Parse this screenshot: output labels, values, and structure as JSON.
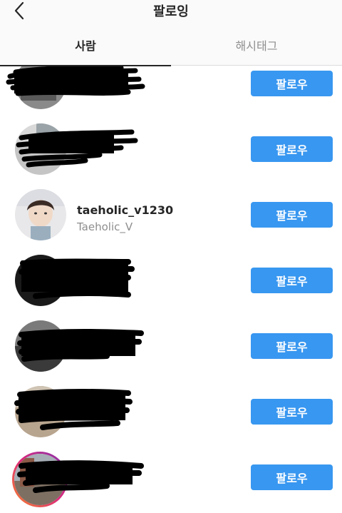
{
  "header": {
    "title": "팔로잉",
    "back_icon": "chevron-left-icon"
  },
  "tabs": [
    {
      "label": "사람",
      "active": true
    },
    {
      "label": "해시태그",
      "active": false
    }
  ],
  "follow_button_color": "#3897f0",
  "rows": [
    {
      "username": "",
      "fullname": "",
      "button": "팔로우",
      "redacted": true
    },
    {
      "username": "",
      "fullname": "",
      "button": "팔로우",
      "redacted": true
    },
    {
      "username": "taeholic_v1230",
      "fullname": "Taeholic_V",
      "button": "팔로우",
      "redacted": false
    },
    {
      "username": "",
      "fullname": "",
      "button": "팔로우",
      "redacted": true
    },
    {
      "username": "",
      "fullname": "",
      "button": "팔로우",
      "redacted": true
    },
    {
      "username": "",
      "fullname": "",
      "button": "팔로우",
      "redacted": true
    },
    {
      "username": "",
      "fullname": "",
      "button": "팔로우",
      "redacted": true
    }
  ]
}
